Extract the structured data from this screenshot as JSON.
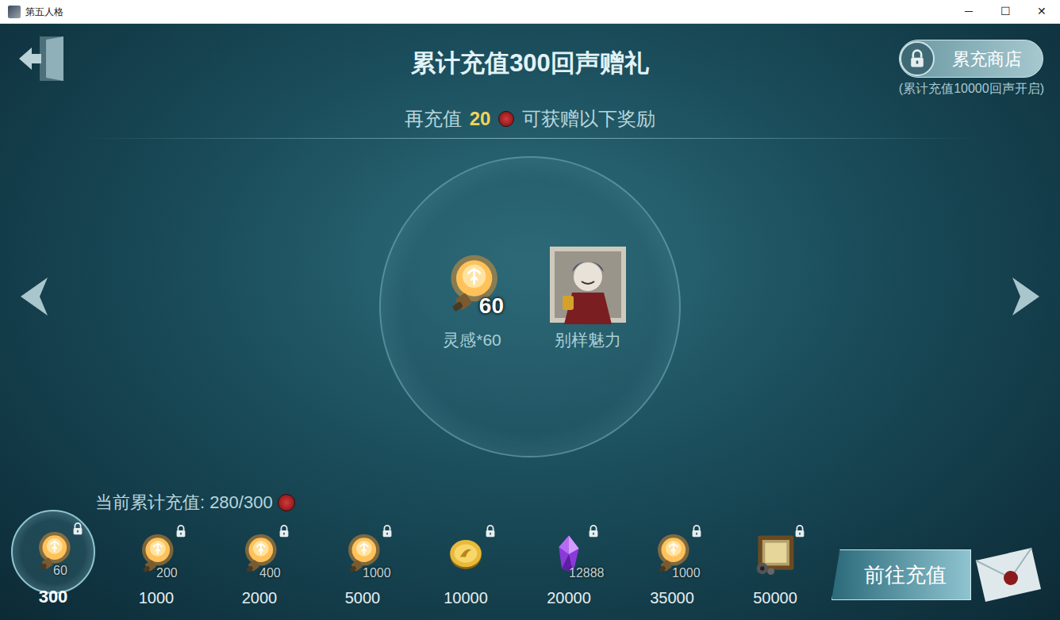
{
  "window": {
    "title": "第五人格",
    "controls": [
      "─",
      "☐",
      "✕"
    ]
  },
  "header": {
    "title": "累计充值300回声赠礼",
    "subtitle_before": "再充值",
    "subtitle_amount": "20",
    "subtitle_after": "可获赠以下奖励"
  },
  "shop_button": {
    "label": "累充商店",
    "note": "(累计充值10000回声开启)",
    "locked": true
  },
  "rewards": [
    {
      "kind": "inspiration",
      "amount": "60",
      "label": "灵感*60"
    },
    {
      "kind": "portrait",
      "label": "别样魅力"
    }
  ],
  "progress": {
    "label": "当前累计充值:",
    "value": "280/300"
  },
  "tiers": [
    {
      "threshold": "300",
      "amount": "60",
      "kind": "inspiration",
      "selected": true,
      "locked": true
    },
    {
      "threshold": "1000",
      "amount": "200",
      "kind": "inspiration",
      "selected": false,
      "locked": true
    },
    {
      "threshold": "2000",
      "amount": "400",
      "kind": "inspiration",
      "selected": false,
      "locked": true
    },
    {
      "threshold": "5000",
      "amount": "1000",
      "kind": "inspiration",
      "selected": false,
      "locked": true
    },
    {
      "threshold": "10000",
      "kind": "coin",
      "selected": false,
      "locked": true
    },
    {
      "threshold": "20000",
      "amount": "12888",
      "kind": "crystal",
      "selected": false,
      "locked": true
    },
    {
      "threshold": "35000",
      "amount": "1000",
      "kind": "inspiration",
      "selected": false,
      "locked": true
    },
    {
      "threshold": "50000",
      "kind": "film",
      "selected": false,
      "locked": true
    }
  ],
  "recharge_button": {
    "label": "前往充值"
  }
}
